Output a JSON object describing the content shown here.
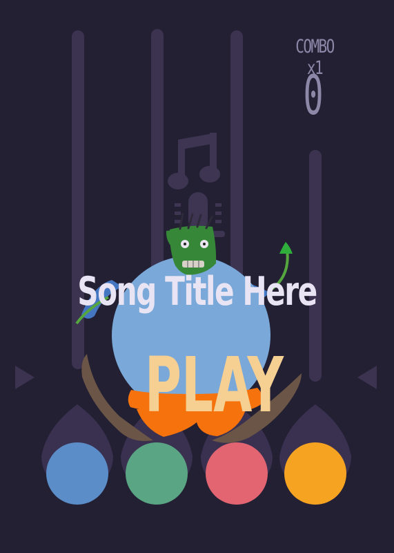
{
  "hud": {
    "combo": "COMBO x1",
    "score": "0"
  },
  "song": {
    "title": "Song Title Here"
  },
  "menu": {
    "play_label": "PLAY"
  },
  "pads": [
    {
      "name": "blue",
      "color": "#5b8ec9"
    },
    {
      "name": "green",
      "color": "#5aa583"
    },
    {
      "name": "red",
      "color": "#e26571"
    },
    {
      "name": "orange",
      "color": "#f7a322"
    }
  ],
  "colors": {
    "background": "#232034",
    "lane": "#3b3350",
    "pad_socket": "#3a3150",
    "hud_text": "#8d87a8",
    "title_text": "#e9e4f4",
    "play_text": "#f6cf93"
  },
  "icons": {
    "music": "music-note-icon",
    "microphone": "microphone-icon",
    "left_arrow": "triangle-left",
    "right_arrow": "triangle-right"
  }
}
